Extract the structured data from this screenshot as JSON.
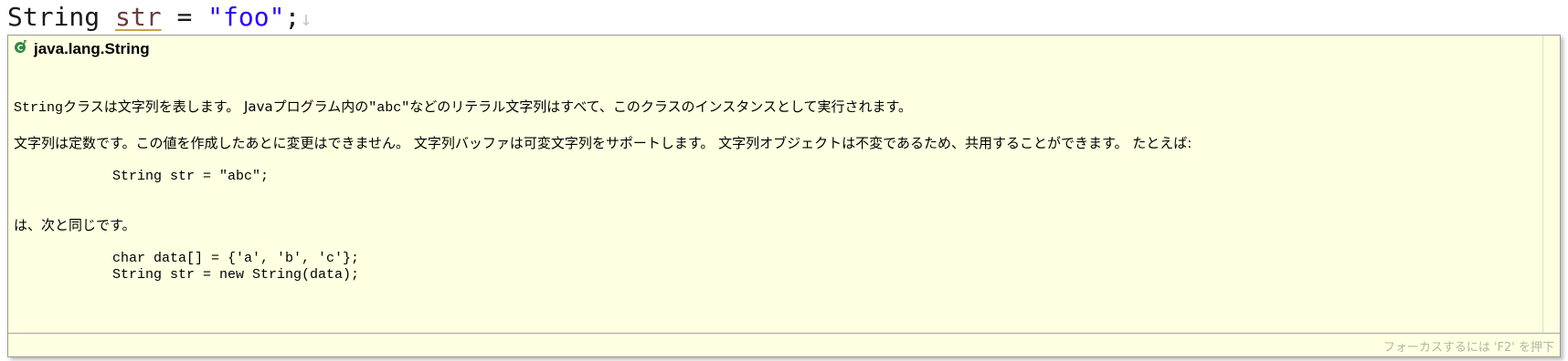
{
  "editor": {
    "code": {
      "type": "String",
      "variable": "str",
      "operator": " = ",
      "literal": "\"foo\"",
      "terminator": ";",
      "line_end_marker": "↓"
    }
  },
  "hover": {
    "title": "java.lang.String",
    "icon": "class-icon",
    "para1_code": "String",
    "para1_text_a": "クラスは文字列を表します。 Javaプログラム内の",
    "para1_code2": "\"abc\"",
    "para1_text_b": "などのリテラル文字列はすべて、このクラスのインスタンスとして実行されます。",
    "para2": "文字列は定数です。この値を作成したあとに変更はできません。 文字列バッファは可変文字列をサポートします。 文字列オブジェクトは不変であるため、共用することができます。 たとえば:",
    "code1": "String str = \"abc\";",
    "para3": "は、次と同じです。",
    "code2": "char data[] = {'a', 'b', 'c'};\nString str = new String(data);",
    "footer_hint": "フォーカスするには 'F2' を押下"
  },
  "colors": {
    "hover_background": "#ffffe1",
    "string_literal": "#2a00ff",
    "variable": "#6a3e3e",
    "class_icon": "#2e8b3a"
  }
}
